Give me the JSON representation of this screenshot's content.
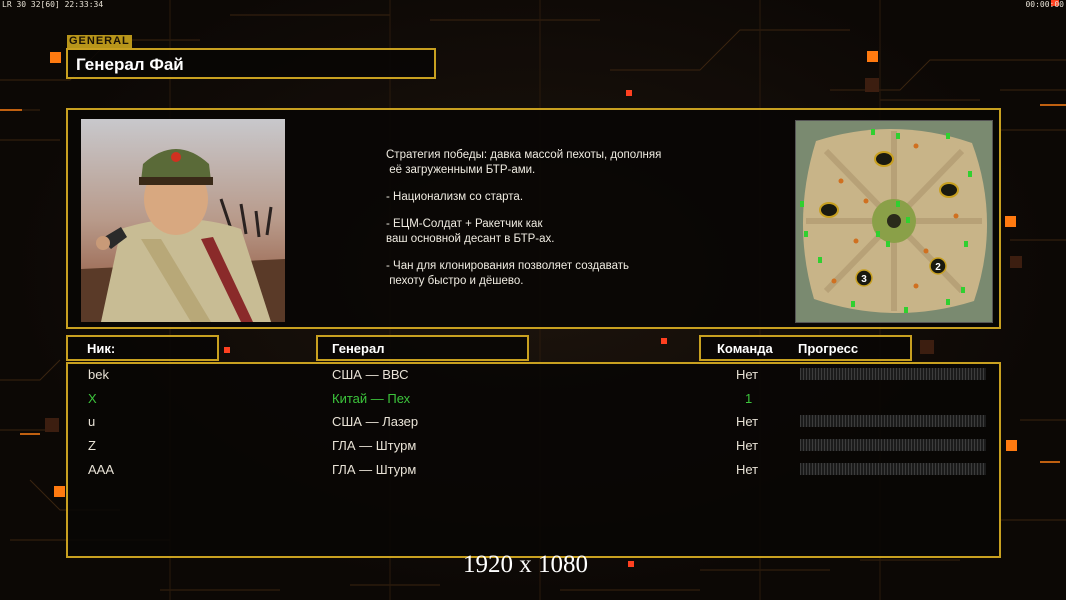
{
  "hud": {
    "top_left": "LR 30 32[60] 22:33:34",
    "top_right": "00:00:00"
  },
  "general": {
    "tag": "GENERAL",
    "name": "Генерал Фай",
    "portrait_icon": "general-portrait-icon",
    "description": [
      "Стратегия победы: давка массой пехоты, дополняя\n её загруженными БТР-ами.",
      "- Национализм со старта.",
      "- ЕЦМ-Солдат + Ракетчик как\nваш основной десант в БТР-ах.",
      "- Чан для клонирования позволяет создавать\n пехоту быстро и дёшево."
    ]
  },
  "map": {
    "icon": "minimap-icon",
    "spawn_labels": [
      "3",
      "2"
    ]
  },
  "columns": {
    "nick": "Ник:",
    "general": "Генерал",
    "team": "Команда",
    "progress": "Прогресс"
  },
  "players": [
    {
      "nick": "bek",
      "general": "США — ВВС",
      "team": "Нет",
      "progress_bar": true,
      "active": false
    },
    {
      "nick": "X",
      "general": "Китай — Пех",
      "team": "1",
      "progress_bar": false,
      "active": true
    },
    {
      "nick": "u",
      "general": "США — Лазер",
      "team": "Нет",
      "progress_bar": true,
      "active": false
    },
    {
      "nick": "Z",
      "general": "ГЛА — Штурм",
      "team": "Нет",
      "progress_bar": true,
      "active": false
    },
    {
      "nick": "AAA",
      "general": "ГЛА — Штурм",
      "team": "Нет",
      "progress_bar": true,
      "active": false
    }
  ],
  "resolution": "1920 x 1080",
  "colors": {
    "frame": "#c8a020",
    "active_player": "#3cc43c",
    "accent": "#ff7a10"
  }
}
